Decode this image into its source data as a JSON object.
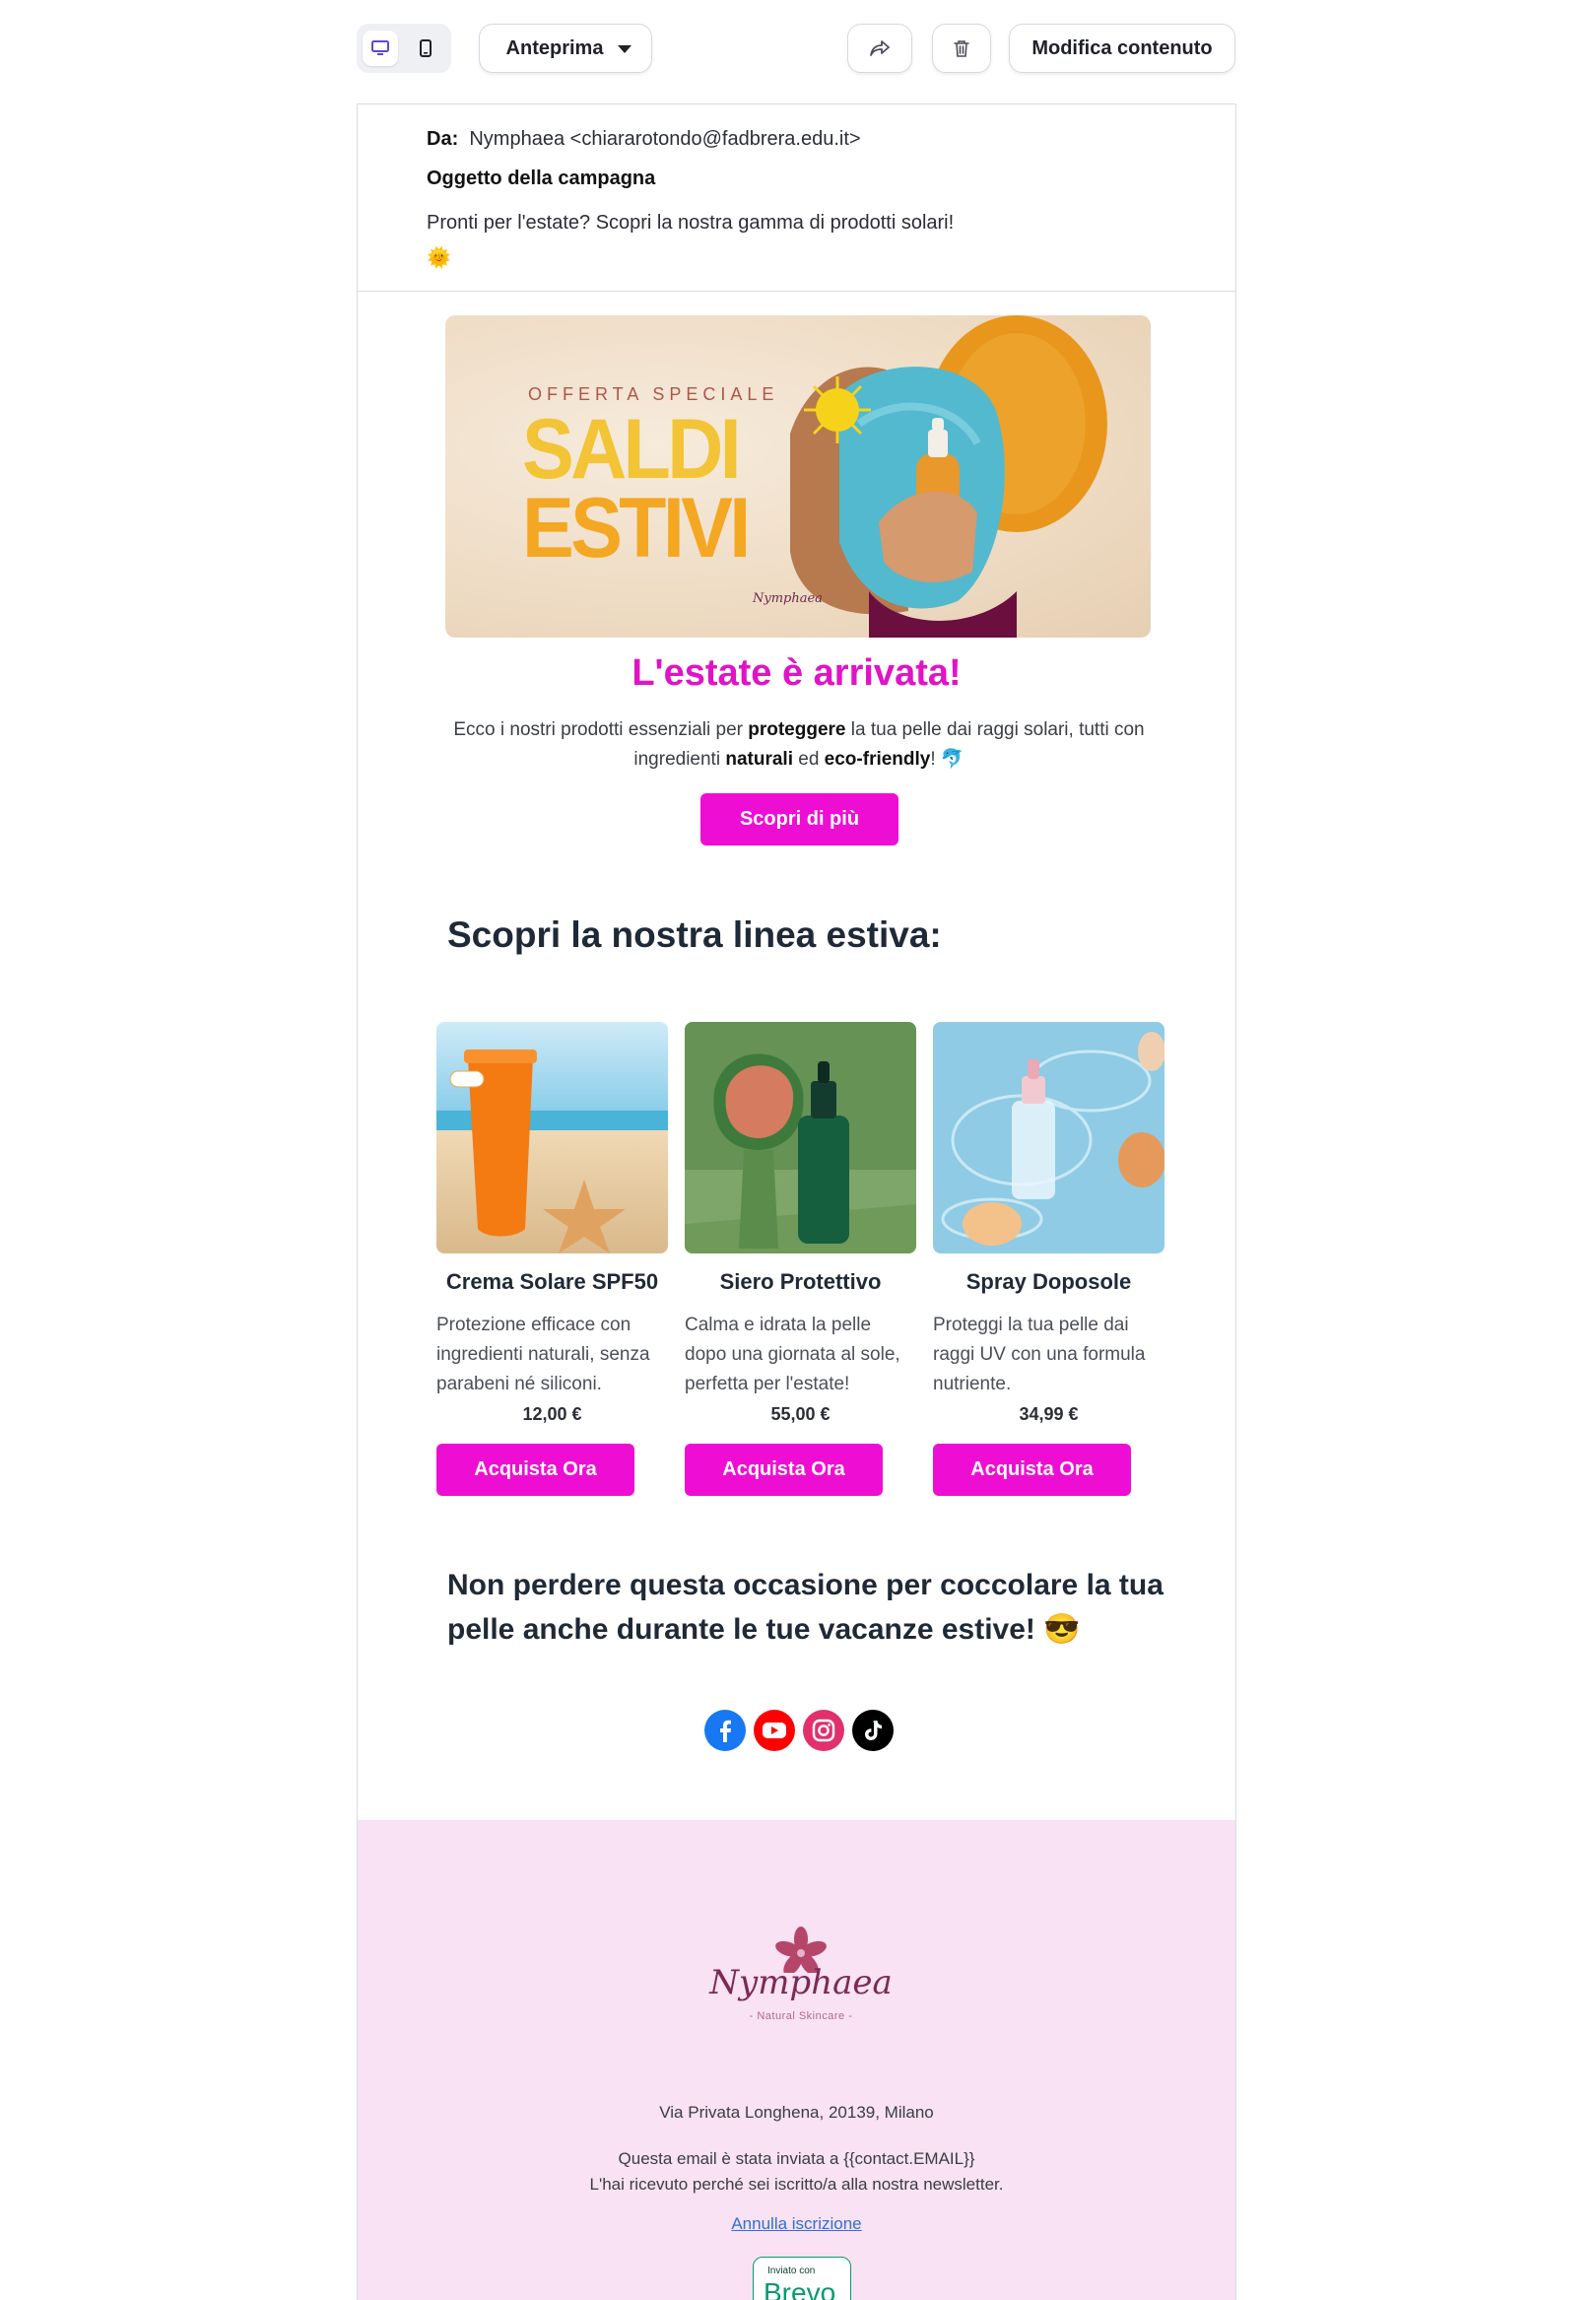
{
  "toolbar": {
    "preview_label": "Anteprima",
    "edit_label": "Modifica contenuto",
    "device_desktop_icon": "desktop-icon",
    "device_mobile_icon": "mobile-icon",
    "share_icon": "share-icon",
    "trash_icon": "trash-icon"
  },
  "header": {
    "from_label": "Da:",
    "from_value": "Nymphaea <chiararotondo@fadbrera.edu.it>",
    "subject_label": "Oggetto della campagna",
    "subject_value": "Pronti per l'estate? Scopri la nostra gamma di prodotti solari!",
    "subject_emoji": "🌞"
  },
  "banner": {
    "offer": "OFFERTA SPECIALE",
    "saldi": "SALDI",
    "estivi": "ESTIVI",
    "brand": "Nymphaea"
  },
  "hero": {
    "headline": "L'estate è arrivata!",
    "intro_1": "Ecco i nostri prodotti essenziali per ",
    "intro_b1": "proteggere",
    "intro_2": " la tua pelle dai raggi solari, tutti con ingredienti ",
    "intro_b2": "naturali",
    "intro_3": " ed ",
    "intro_b3": "eco-friendly",
    "intro_4": "! 🐬",
    "cta": "Scopri di più"
  },
  "section_title": "Scopri la nostra linea estiva:",
  "products": [
    {
      "name": "Crema Solare SPF50",
      "desc": "Protezione efficace con ingredienti naturali, senza parabeni né siliconi.",
      "price": "12,00 €",
      "buy": "Acquista Ora"
    },
    {
      "name": "Siero Protettivo",
      "desc": "Calma e idrata la pelle dopo una giornata al sole, perfetta per l'estate!",
      "price": "55,00 €",
      "buy": "Acquista Ora"
    },
    {
      "name": "Spray Doposole",
      "desc": "Proteggi la tua pelle dai raggi UV con una formula nutriente.",
      "price": "34,99 €",
      "buy": "Acquista Ora"
    }
  ],
  "closing": "Non perdere questa occasione per coccolare la tua pelle anche durante le tue vacanze estive! 😎",
  "socials": [
    "facebook-icon",
    "youtube-icon",
    "instagram-icon",
    "tiktok-icon"
  ],
  "footer": {
    "logo_word": "Nymphaea",
    "logo_sub": "- Natural Skincare -",
    "address": "Via Privata Longhena, 20139, Milano",
    "sent_line1": "Questa email è stata inviata a {{contact.EMAIL}}",
    "sent_line2": "L'hai ricevuto perché sei iscritto/a alla nostra newsletter.",
    "unsubscribe": "Annulla iscrizione",
    "brevo_small": "Inviato con",
    "brevo_big": "Brevo"
  },
  "colors": {
    "accent": "#ee0ed3",
    "headline": "#e014c6",
    "footer_bg": "#f8e2f3",
    "brevo": "#0b996e"
  }
}
